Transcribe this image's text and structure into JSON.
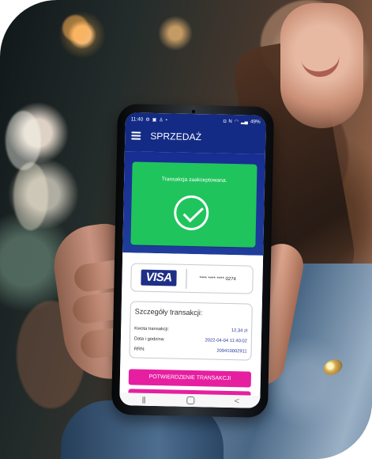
{
  "status_bar": {
    "time": "11:40",
    "left_icons": [
      "gear-icon",
      "image-icon",
      "person-icon",
      "dot-icon"
    ],
    "right_icons": [
      "battery-saver-icon",
      "nfc-icon",
      "wifi-icon",
      "signal-icon"
    ],
    "battery": "49%"
  },
  "app": {
    "title": "SPRZEDAŻ"
  },
  "success": {
    "message": "Transakcja zaakceptowana.",
    "icon": "check-circle-icon",
    "color": "#20c45d"
  },
  "card": {
    "brand": "VISA",
    "masked_number": "**** **** **** 0274"
  },
  "details": {
    "title": "Szczegóły transakcji:",
    "rows": [
      {
        "label": "Kwota transakcji:",
        "value": "12,34 zł"
      },
      {
        "label": "Data i godzina:",
        "value": "2022-04-04 11:40:02"
      },
      {
        "label": "RRN:",
        "value": "209410002911"
      }
    ]
  },
  "actions": {
    "confirm_label": "POTWIERDZENIE TRANSAKCJI",
    "accent": "#e61fa1"
  },
  "navigation": {
    "recent": "|||",
    "home": "",
    "back": "<"
  }
}
